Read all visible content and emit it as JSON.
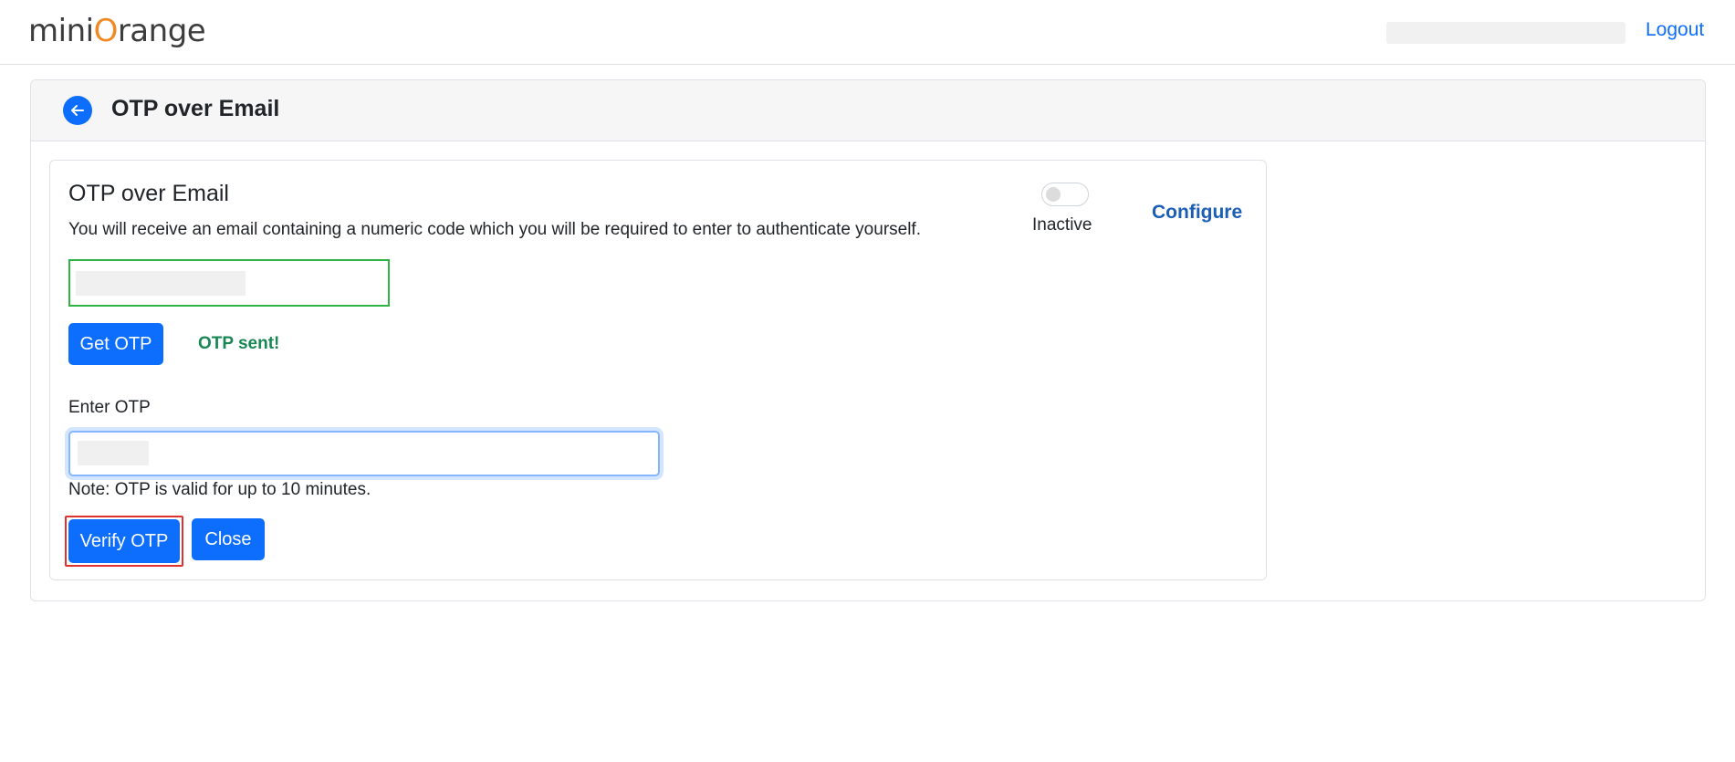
{
  "header": {
    "logo_text": [
      "mini",
      "O",
      "range"
    ],
    "logout_label": "Logout"
  },
  "page": {
    "title": "OTP over Email"
  },
  "method": {
    "title": "OTP over Email",
    "description": "You will receive an email containing a numeric code which you will be required to enter to authenticate yourself.",
    "status": "Inactive",
    "toggle_on": false,
    "configure_label": "Configure",
    "get_otp_label": "Get OTP",
    "otp_sent_message": "OTP sent!",
    "enter_otp_label": "Enter OTP",
    "note": "Note: OTP is valid for up to 10 minutes.",
    "verify_label": "Verify OTP",
    "close_label": "Close"
  },
  "colors": {
    "primary": "#0d6efd",
    "success": "#198754",
    "logo_accent": "#f08a24",
    "highlight": "#e03131"
  }
}
